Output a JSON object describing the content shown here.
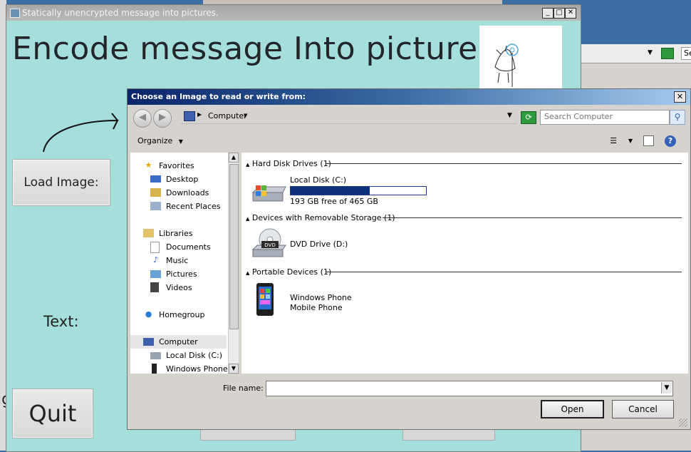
{
  "background": {
    "right_window": {
      "search_label": "Se"
    },
    "left_window": {
      "letters": "ig"
    }
  },
  "app": {
    "title": "Statically unencrypted message into pictures.",
    "heading": "Encode message Into picture",
    "load_button": "Load Image:",
    "text_label": "Text:",
    "quit_button": "Quit",
    "window_buttons": {
      "minimize": "_",
      "maximize": "□",
      "close": "✕"
    }
  },
  "dialog": {
    "title": "Choose an Image to read or write from:",
    "close": "✕",
    "address": {
      "location": "Computer",
      "dropdown_icon": "chevron-down-icon"
    },
    "search_placeholder": "Search Computer",
    "toolbar": {
      "organize": "Organize"
    },
    "nav": {
      "favorites": "Favorites",
      "desktop": "Desktop",
      "downloads": "Downloads",
      "recent_places": "Recent Places",
      "libraries": "Libraries",
      "documents": "Documents",
      "music": "Music",
      "pictures": "Pictures",
      "videos": "Videos",
      "homegroup": "Homegroup",
      "computer": "Computer",
      "local_disk": "Local Disk (C:)",
      "windows_phone": "Windows Phone"
    },
    "groups": {
      "hdd": {
        "header": "Hard Disk Drives (1)",
        "drive_name": "Local Disk (C:)",
        "free_text": "193 GB free of 465 GB",
        "used_fraction": 0.585
      },
      "removable": {
        "header": "Devices with Removable Storage (1)",
        "drive_name": "DVD Drive (D:)",
        "icon_label": "DVD"
      },
      "portable": {
        "header": "Portable Devices (1)",
        "device_name": "Windows Phone",
        "device_type": "Mobile Phone"
      }
    },
    "file_name_label": "File name:",
    "file_name_value": "",
    "open_button": "Open",
    "cancel_button": "Cancel"
  }
}
